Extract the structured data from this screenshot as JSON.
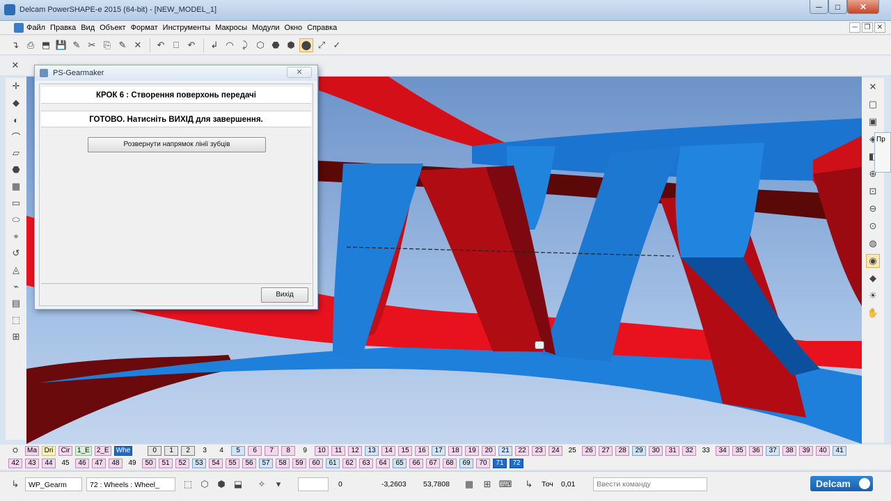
{
  "window": {
    "title": "Delcam PowerSHAPE-e 2015 (64-bit) - [NEW_MODEL_1]",
    "min_label": "─",
    "max_label": "□",
    "close_label": "✕"
  },
  "menu": {
    "items": [
      "Файл",
      "Правка",
      "Вид",
      "Объект",
      "Формат",
      "Инструменты",
      "Макросы",
      "Модули",
      "Окно",
      "Справка"
    ],
    "mdi_min": "─",
    "mdi_restore": "❐",
    "mdi_close": "✕"
  },
  "toolbar_icons": [
    "↴",
    "⎙",
    "⬒",
    "💾",
    "✎",
    "✂",
    "⎘",
    "✎",
    "✕",
    "↶",
    "⎕",
    "↶",
    "↲",
    "◠",
    "⤸",
    "⬡",
    "⬣",
    "⬢",
    "⬤",
    "⤢",
    "✓"
  ],
  "dialog": {
    "title": "PS-Gearmaker",
    "close_label": "✕",
    "step_header": "КРОК 6 : Створення поверхонь передачі",
    "status_message": "ГОТОВО. Натисніть ВИХІД для завершення.",
    "develop_button": "Розвернути напрямок лінії зубців",
    "exit_button": "Вихід"
  },
  "levels": {
    "row1_tabs": [
      "Ма",
      "Dri",
      "Cir",
      "1_E",
      "2_E",
      "Whe"
    ],
    "row1": [
      "0",
      "1",
      "2",
      "3",
      "4",
      "5",
      "6",
      "7",
      "8",
      "9",
      "10",
      "11",
      "12",
      "13",
      "14",
      "15",
      "16",
      "17",
      "18",
      "19",
      "20",
      "21",
      "22",
      "23",
      "24",
      "25",
      "26",
      "27",
      "28",
      "29",
      "30",
      "31",
      "32",
      "33",
      "34",
      "35",
      "36",
      "37",
      "38",
      "39",
      "40",
      "41"
    ],
    "row2": [
      "42",
      "43",
      "44",
      "45",
      "46",
      "47",
      "48",
      "49",
      "50",
      "51",
      "52",
      "53",
      "54",
      "55",
      "56",
      "57",
      "58",
      "59",
      "60",
      "61",
      "62",
      "63",
      "64",
      "65",
      "66",
      "67",
      "68",
      "69",
      "70",
      "71",
      "72"
    ]
  },
  "statusbar": {
    "workplane": "WP_Gearm",
    "level_select": "72 : Wheels : Wheel_",
    "x_value": "0",
    "y_value": "-3,2603",
    "z_value": "53,7808",
    "tolerance_label": "Точ",
    "tolerance_value": "0,01",
    "command_placeholder": "Ввести команду",
    "logo": "Delcam"
  },
  "right_flyout": {
    "label": "Пр"
  },
  "colors": {
    "gear_red": "#e8121f",
    "gear_red_dark": "#a00812",
    "gear_blue": "#1877d6",
    "gear_blue_dark": "#0c4f9c",
    "background_blue": "#9fbde4"
  }
}
